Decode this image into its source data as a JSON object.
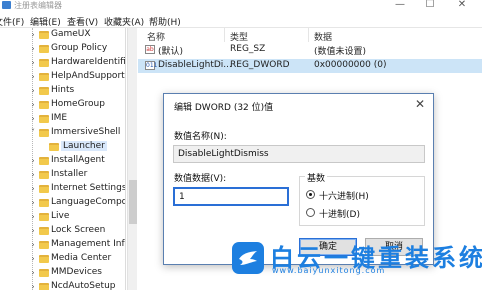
{
  "window": {
    "title": "注册表编辑器",
    "controls": [
      "—",
      "☐",
      "✕"
    ]
  },
  "menubar": [
    "文件(F)",
    "编辑(E)",
    "查看(V)",
    "收藏夹(A)",
    "帮助(H)"
  ],
  "tree": {
    "items": [
      {
        "label": "GameUX",
        "expander": "›"
      },
      {
        "label": "Group Policy",
        "expander": "›"
      },
      {
        "label": "HardwareIdentifica",
        "expander": "›"
      },
      {
        "label": "HelpAndSupport",
        "expander": "›"
      },
      {
        "label": "Hints",
        "expander": "›"
      },
      {
        "label": "HomeGroup",
        "expander": "›"
      },
      {
        "label": "IME",
        "expander": "›"
      },
      {
        "label": "ImmersiveShell",
        "expander": "˅"
      },
      {
        "label": "Launcher",
        "expander": "",
        "selected": true
      },
      {
        "label": "InstallAgent",
        "expander": "›"
      },
      {
        "label": "Installer",
        "expander": "›"
      },
      {
        "label": "Internet Settings",
        "expander": "›"
      },
      {
        "label": "LanguageCompone",
        "expander": "›"
      },
      {
        "label": "Live",
        "expander": "›"
      },
      {
        "label": "Lock Screen",
        "expander": "›"
      },
      {
        "label": "Management Infra",
        "expander": "›"
      },
      {
        "label": "Media Center",
        "expander": "›"
      },
      {
        "label": "MMDevices",
        "expander": "›"
      },
      {
        "label": "NcdAutoSetup",
        "expander": "›"
      }
    ]
  },
  "list": {
    "headers": {
      "name": "名称",
      "type": "类型",
      "data": "数据"
    },
    "rows": [
      {
        "icon": "ab",
        "name": "(默认)",
        "type": "REG_SZ",
        "data": "(数值未设置)"
      },
      {
        "icon": "011",
        "name": "DisableLightDi...",
        "type": "REG_DWORD",
        "data": "0x00000000 (0)",
        "selected": true
      }
    ]
  },
  "dialog": {
    "title": "编辑 DWORD (32 位)值",
    "close": "✕",
    "value_name_label": "数值名称(N):",
    "value_name": "DisableLightDismiss",
    "value_data_label": "数值数据(V):",
    "value_data": "1",
    "base_label": "基数",
    "radix_hex": "十六进制(H)",
    "radix_dec": "十进制(D)",
    "ok": "确定",
    "cancel": "取消"
  },
  "watermark": {
    "main": "白云一键重装系统",
    "url": "www.baiyunxitong.com"
  },
  "colors": {
    "accent": "#1d7fe0",
    "selection": "#cce4f7",
    "folder": "#f2c94c"
  }
}
